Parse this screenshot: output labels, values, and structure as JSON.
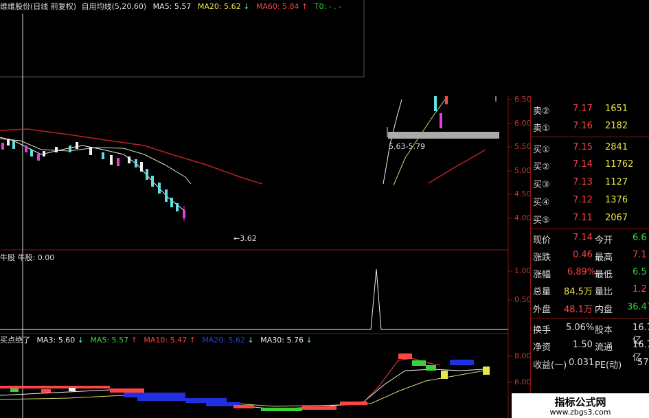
{
  "header": {
    "title": "维维股份(日线 前复权)",
    "indicator_name": "自用均线(5,20,60)",
    "ma5": "MA5: 5.57",
    "ma20": "MA20: 5.62",
    "ma60": "MA60: 5.84",
    "t0": "T0: - . -"
  },
  "main_chart": {
    "range_label": "5.63-5.79",
    "low_marker": "←3.62",
    "y_ticks": [
      "6.50",
      "6.00",
      "5.50",
      "5.00",
      "4.50",
      "4.00"
    ]
  },
  "panel2": {
    "title": "牛股 牛股: 0.00",
    "y_ticks": [
      "1.00",
      "0.50"
    ]
  },
  "panel3": {
    "title": "买点绝了",
    "ma3": "MA3: 5.60",
    "ma5": "MA5: 5.57",
    "ma10": "MA10: 5.47",
    "ma20": "MA20: 5.62",
    "ma30": "MA30: 5.76",
    "y_ticks": [
      "8.00",
      "6.00"
    ]
  },
  "order_book": {
    "asks": [
      {
        "label": "卖②",
        "price": "7.17",
        "volume": "1651"
      },
      {
        "label": "卖①",
        "price": "7.16",
        "volume": "2182"
      }
    ],
    "bids": [
      {
        "label": "买①",
        "price": "7.15",
        "volume": "2841"
      },
      {
        "label": "买②",
        "price": "7.14",
        "volume": "11762"
      },
      {
        "label": "买③",
        "price": "7.13",
        "volume": "1127"
      },
      {
        "label": "买④",
        "price": "7.12",
        "volume": "1376"
      },
      {
        "label": "买⑤",
        "price": "7.11",
        "volume": "2067"
      }
    ]
  },
  "quote": {
    "price_label": "现价",
    "price": "7.14",
    "open_label": "今开",
    "open": "6.6",
    "change_label": "涨跌",
    "change": "0.46",
    "high_label": "最高",
    "high": "7.1",
    "pct_label": "涨幅",
    "pct": "6.89%",
    "low_label": "最低",
    "low": "6.5",
    "vol_label": "总量",
    "vol": "84.5万",
    "ratio_label": "量比",
    "ratio": "1.2",
    "outer_label": "外盘",
    "outer": "48.1万",
    "inner_label": "内盘",
    "inner": "36.47"
  },
  "fundamentals": {
    "turnover_label": "换手",
    "turnover": "5.06%",
    "shares_label": "股本",
    "shares": "16.7亿",
    "nav_label": "净资",
    "nav": "1.50",
    "float_label": "流通",
    "float": "16.7亿",
    "eps_label": "收益(一)",
    "eps": "0.031",
    "pe_label": "PE(动)",
    "pe": "57."
  },
  "watermark": {
    "title": "指标公式网",
    "url": "www.zbgs3.com"
  },
  "colors": {
    "up": "#ff4444",
    "down": "#5fe0e0",
    "ma60": "#c02020",
    "ma20": "#e0e0c0",
    "yellow": "#e8e84a",
    "green": "#3ad23a",
    "magenta": "#e040e0"
  }
}
